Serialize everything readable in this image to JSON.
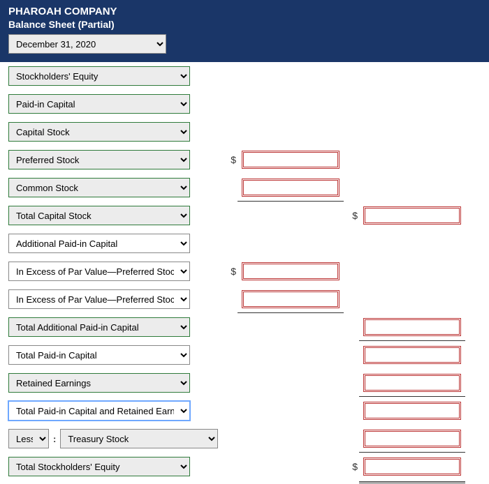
{
  "header": {
    "company": "PHAROAH COMPANY",
    "subtitle": "Balance Sheet (Partial)",
    "date": "December 31, 2020"
  },
  "rows": {
    "stockholders_equity": "Stockholders' Equity",
    "paid_in_capital": "Paid-in Capital",
    "capital_stock": "Capital Stock",
    "preferred_stock": "Preferred Stock",
    "common_stock": "Common Stock",
    "total_capital_stock": "Total Capital Stock",
    "additional_paid_in": "Additional Paid-in Capital",
    "excess_preferred_1": "In Excess of Par Value—Preferred Stock",
    "excess_preferred_2": "In Excess of Par Value—Preferred Stock",
    "total_additional": "Total Additional Paid-in Capital",
    "total_paid_in": "Total Paid-in Capital",
    "retained_earnings": "Retained Earnings",
    "total_paid_retained": "Total Paid-in Capital and Retained Earnings",
    "less": "Less",
    "treasury_stock": "Treasury Stock",
    "total_stockholders": "Total Stockholders' Equity"
  },
  "symbols": {
    "dollar": "$",
    "colon": ":"
  },
  "amounts": {
    "preferred_stock": "",
    "common_stock": "",
    "total_capital_stock": "",
    "excess_preferred_1": "",
    "excess_preferred_2": "",
    "total_additional": "",
    "total_paid_in": "",
    "retained_earnings": "",
    "total_paid_retained": "",
    "treasury_stock": "",
    "total_stockholders": ""
  }
}
